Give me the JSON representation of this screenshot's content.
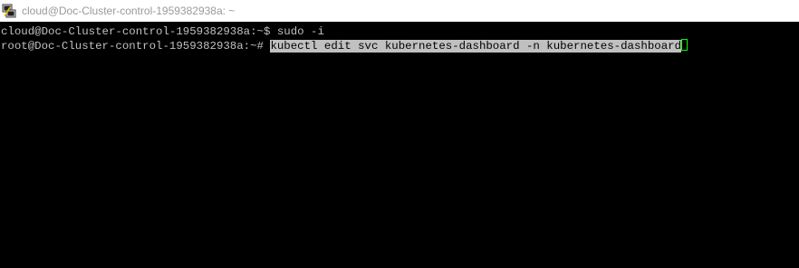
{
  "window": {
    "title": "cloud@Doc-Cluster-control-1959382938a: ~",
    "icon": "putty-icon"
  },
  "terminal": {
    "lines": [
      {
        "prompt": "cloud@Doc-Cluster-control-1959382938a:~$ ",
        "command": "sudo -i"
      },
      {
        "prompt": "root@Doc-Cluster-control-1959382938a:~# ",
        "command": "kubectl edit svc kubernetes-dashboard -n kubernetes-dashboard"
      }
    ]
  },
  "colors": {
    "background": "#000000",
    "foreground": "#c0c0c0",
    "selection": "#c0c0c0",
    "cursor": "#00ff00"
  }
}
